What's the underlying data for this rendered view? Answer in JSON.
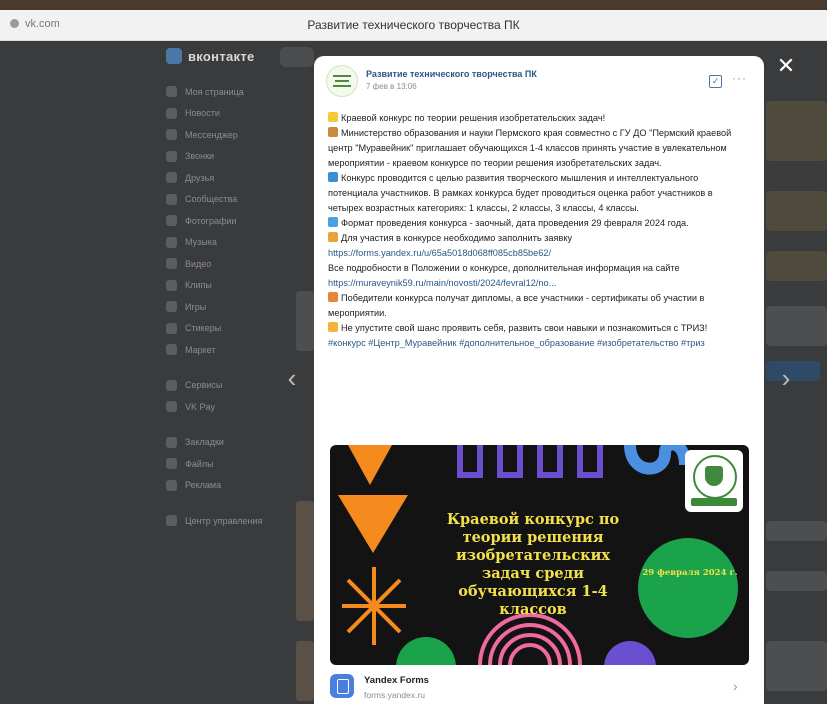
{
  "browser": {
    "url": "vk.com",
    "window_title": "Развитие технического творчества ПК"
  },
  "vk": {
    "logo": "вконтакте",
    "sidebar": {
      "items": [
        "Моя страница",
        "Новости",
        "Мессенджер",
        "Звонки",
        "Друзья",
        "Сообщества",
        "Фотографии",
        "Музыка",
        "Видео",
        "Клипы",
        "Игры",
        "Стикеры",
        "Маркет"
      ],
      "items2": [
        "Сервисы",
        "VK Pay"
      ],
      "items3": [
        "Закладки",
        "Файлы",
        "Реклама"
      ],
      "items4": [
        "Центр управления"
      ]
    }
  },
  "post": {
    "group_name": "Развитие технического творчества ПК",
    "date": "7 фев в 13:06",
    "lines": [
      "Краевой конкурс по теории решения изобретательских задач!",
      "Министерство образования и науки Пермского края совместно с ГУ ДО \"Пермский краевой центр \"Муравейник\" приглашает обучающихся 1-4 классов принять участие в увлекательном мероприятии - краевом конкурсе по теории решения изобретательских задач.",
      "Конкурс проводится с целью развития творческого мышления и интеллектуального потенциала участников. В рамках конкурса будет проводиться оценка работ участников в четырех возрастных категориях: 1 классы, 2 классы, 3 классы, 4 классы.",
      "Формат проведения конкурса - заочный, дата проведения 29 февраля 2024 года.",
      "Для участия в конкурсе необходимо заполнить заявку"
    ],
    "link1": "https://forms.yandex.ru/u/65a5018d068ff085cb85be62/",
    "line_more": "Все подробности в Положении о конкурсе, дополнительная информация на сайте",
    "link2": "https://muraveynik59.ru/main/novosti/2024/fevral12/no...",
    "line_winners": "Победители конкурса получат дипломы, а все участники - сертификаты об участии в мероприятии.",
    "line_chance": "Не упустите свой шанс проявить себя, развить свои навыки и познакомиться с ТРИЗ!",
    "tags": "#конкурс #Центр_Муравейник #дополнительное_образование #изобретательство #триз",
    "banner": {
      "title": "Краевой конкурс по теории решения изобретательских задач среди обучающихся 1-4 классов",
      "date": "29 февраля 2024 г."
    },
    "card": {
      "title": "Yandex Forms",
      "url": "forms.yandex.ru"
    }
  },
  "icons": {
    "close": "✕",
    "prev": "‹",
    "next": "›",
    "more": "···",
    "check": "✓",
    "chevron": "›"
  },
  "colors": {
    "link": "#2a5885",
    "banner_yellow": "#f4e04d",
    "banner_orange": "#f58a1f",
    "banner_green": "#1aa34a",
    "banner_purple": "#6a4fd1",
    "banner_pink": "#f06aa0"
  }
}
